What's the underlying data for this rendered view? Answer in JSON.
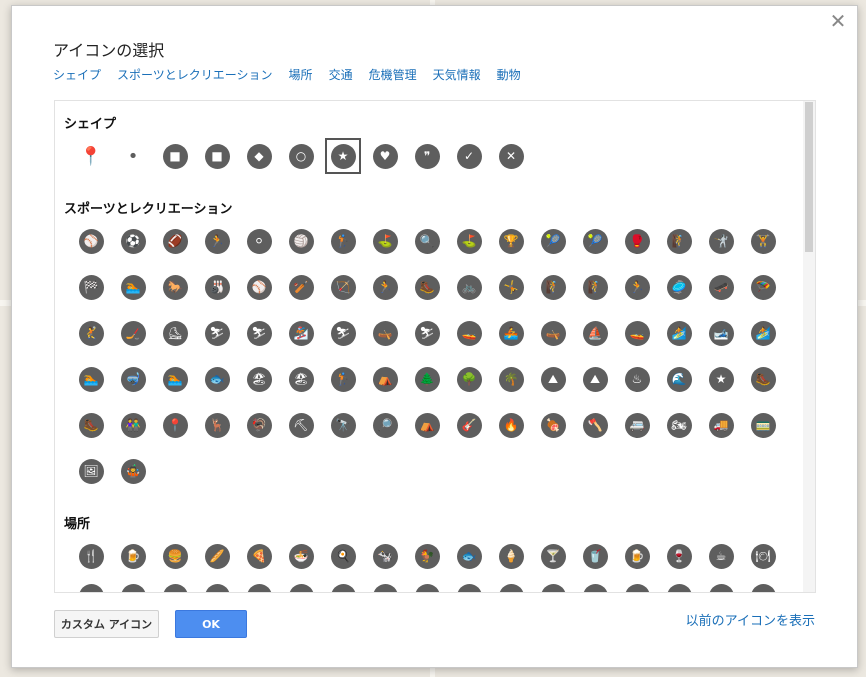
{
  "dialog": {
    "title": "アイコンの選択",
    "close_icon": "close-icon",
    "tabs": [
      "シェイプ",
      "スポーツとレクリエーション",
      "場所",
      "交通",
      "危機管理",
      "天気情報",
      "動物"
    ]
  },
  "sections": {
    "shapes": {
      "title": "シェイプ",
      "icons": [
        {
          "name": "map-pin-icon",
          "glyph": "📍"
        },
        {
          "name": "small-dot-icon",
          "glyph": "•"
        },
        {
          "name": "circle-square-icon",
          "glyph": "■"
        },
        {
          "name": "square-icon",
          "glyph": "■"
        },
        {
          "name": "diamond-icon",
          "glyph": "◆"
        },
        {
          "name": "ring-icon",
          "glyph": "○"
        },
        {
          "name": "star-circle-icon",
          "glyph": "★",
          "selected": true
        },
        {
          "name": "heart-icon",
          "glyph": "♥"
        },
        {
          "name": "quote-icon",
          "glyph": "❞"
        },
        {
          "name": "check-icon",
          "glyph": "✓"
        },
        {
          "name": "x-icon",
          "glyph": "✕"
        }
      ]
    },
    "sports": {
      "title": "スポーツとレクリエーション",
      "rows": [
        [
          "⚾",
          "⚽",
          "🏈",
          "🏃",
          "⚪",
          "🏐",
          "🏌",
          "⛳",
          "🔍",
          "⛳",
          "🏆",
          "🎾",
          "🎾",
          "🥊",
          "🧗",
          "🤺",
          "🏋"
        ],
        [
          "🏁",
          "🏊",
          "🐎",
          "🎳",
          "⚾",
          "🏏",
          "🏹",
          "🏃",
          "🥾",
          "🚲",
          "🤸",
          "🧗",
          "🧗",
          "🏃",
          "🥏",
          "🛹",
          "🪂"
        ],
        [
          "🤾",
          "🏒",
          "⛸",
          "⛷",
          "⛷",
          "🏂",
          "⛷",
          "🛶",
          "⛷",
          "🚤",
          "🚣",
          "🛶",
          "⛵",
          "🚤",
          "🏄",
          "🎿",
          "🏄"
        ],
        [
          "🏊",
          "🤿",
          "🏊",
          "🐟",
          "🏖",
          "🏖",
          "🏌",
          "⛺",
          "🌲",
          "🌳",
          "🌴",
          "⛰",
          "⛰",
          "♨",
          "🌊",
          "★",
          "🥾"
        ],
        [
          "🥾",
          "👫",
          "📍",
          "🦌",
          "🦃",
          "⛏",
          "🔭",
          "🔎",
          "⛺",
          "🎸",
          "🔥",
          "🍖",
          "🪓",
          "🚐",
          "🏍",
          "🚚",
          "🚃"
        ],
        [
          "🖼",
          "🤹"
        ]
      ]
    },
    "places": {
      "title": "場所",
      "icons": [
        "🍴",
        "🍺",
        "🍔",
        "🥖",
        "🍕",
        "🍜",
        "🍳",
        "🐄",
        "🐓",
        "🐟",
        "🍦",
        "🍸",
        "🥤",
        "🍺",
        "🍷",
        "☕",
        "🍽"
      ]
    }
  },
  "footer": {
    "custom_icon_label": "カスタム アイコン",
    "ok_label": "OK",
    "previous_icons_link": "以前のアイコンを表示"
  }
}
